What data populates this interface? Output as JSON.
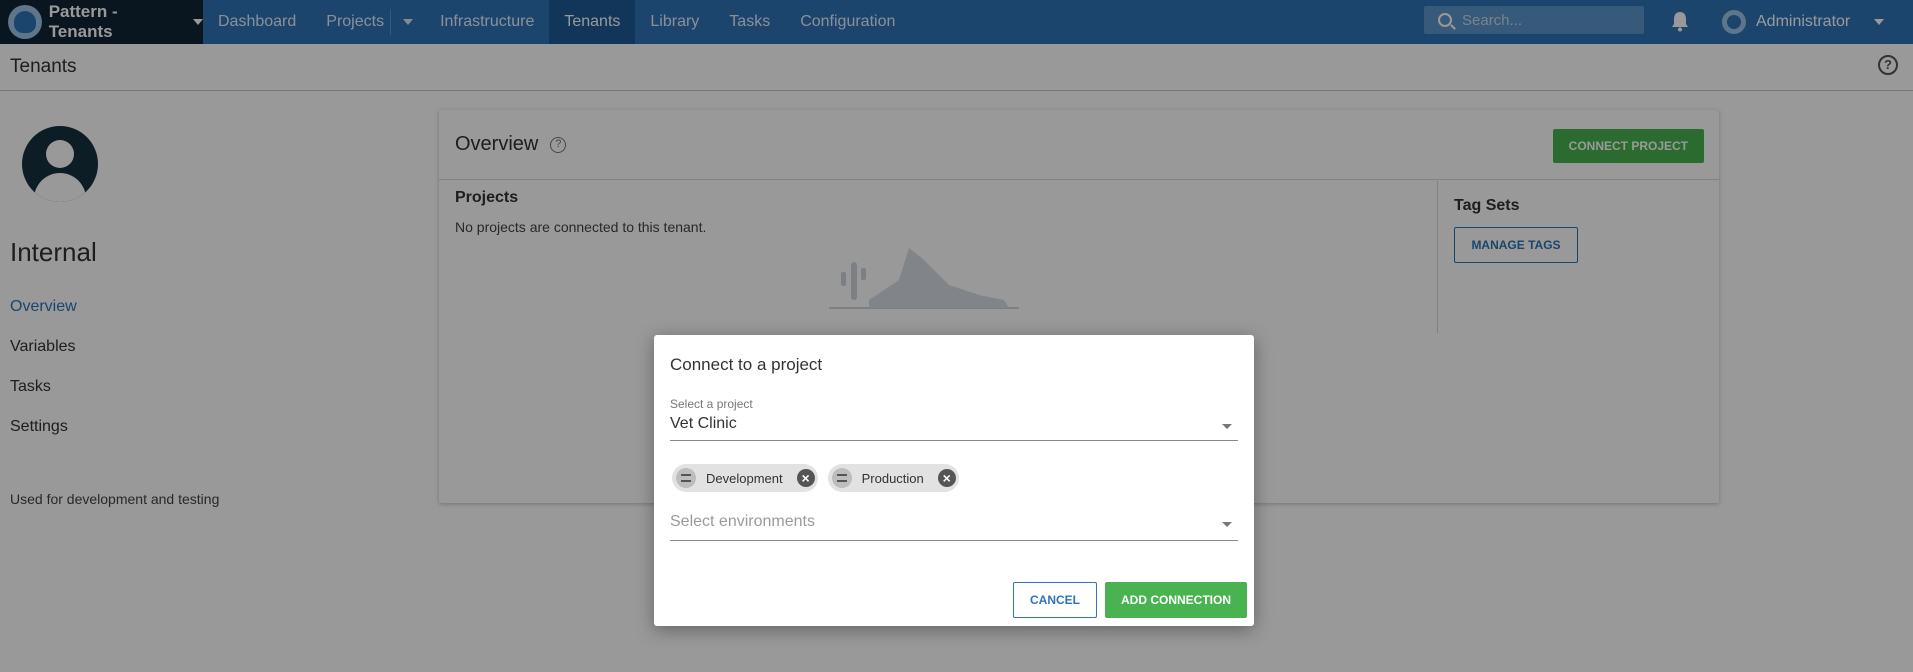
{
  "topnav": {
    "space_name": "Pattern - Tenants",
    "items": [
      {
        "label": "Dashboard"
      },
      {
        "label": "Projects"
      },
      {
        "label": "Infrastructure"
      },
      {
        "label": "Tenants"
      },
      {
        "label": "Library"
      },
      {
        "label": "Tasks"
      },
      {
        "label": "Configuration"
      }
    ],
    "active_item": "Tenants",
    "search_placeholder": "Search...",
    "user_name": "Administrator"
  },
  "page": {
    "title": "Tenants"
  },
  "sidebar": {
    "tenant_name": "Internal",
    "links": [
      {
        "label": "Overview"
      },
      {
        "label": "Variables"
      },
      {
        "label": "Tasks"
      },
      {
        "label": "Settings"
      }
    ],
    "active_link": "Overview",
    "description": "Used for development and testing"
  },
  "card": {
    "title": "Overview",
    "connect_button": "CONNECT PROJECT",
    "projects_heading": "Projects",
    "projects_empty": "No projects are connected to this tenant.",
    "tagsets_heading": "Tag Sets",
    "manage_tags_button": "MANAGE TAGS"
  },
  "dialog": {
    "title": "Connect to a project",
    "project_label": "Select a project",
    "project_value": "Vet Clinic",
    "environments": [
      {
        "label": "Development"
      },
      {
        "label": "Production"
      }
    ],
    "environments_placeholder": "Select environments",
    "cancel_button": "CANCEL",
    "add_button": "ADD CONNECTION"
  },
  "colors": {
    "nav_bg": "#2f73b8",
    "space_bg": "#0f2535",
    "accent_green": "#48b350",
    "link_blue": "#2f73b8"
  }
}
